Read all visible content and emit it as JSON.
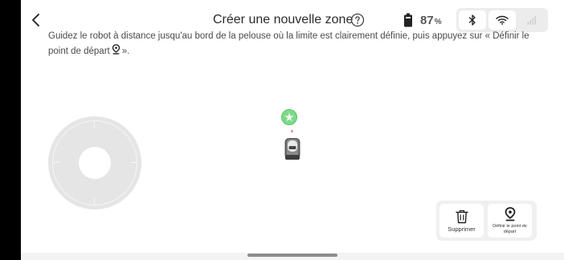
{
  "header": {
    "title": "Créer une nouvelle zone",
    "battery_value": "87",
    "battery_unit": "%"
  },
  "connectivity": {
    "bluetooth": "on",
    "wifi": "on",
    "cellular": "off"
  },
  "instruction": {
    "text_before": "Guidez le robot à distance jusqu'au bord de la pelouse où la limite est clairement définie, puis appuyez sur « Définir le point de départ",
    "text_after": "»."
  },
  "actions": {
    "delete_label": "Supprimer",
    "set_start_label": "Définir le point de départ"
  },
  "icons": {
    "back": "back-arrow-icon",
    "help": "question-mark-icon",
    "battery": "battery-icon",
    "bluetooth": "bluetooth-icon",
    "wifi": "wifi-icon",
    "cellular": "cellular-signal-icon",
    "start_pin": "location-pin-icon",
    "delete": "trash-icon"
  },
  "colors": {
    "start_marker": "#7fd98a",
    "start_marker_border": "#5cc46a",
    "direction_dot": "#e58d8d",
    "joystick": "#e5e5e5",
    "panel": "#ececec"
  }
}
